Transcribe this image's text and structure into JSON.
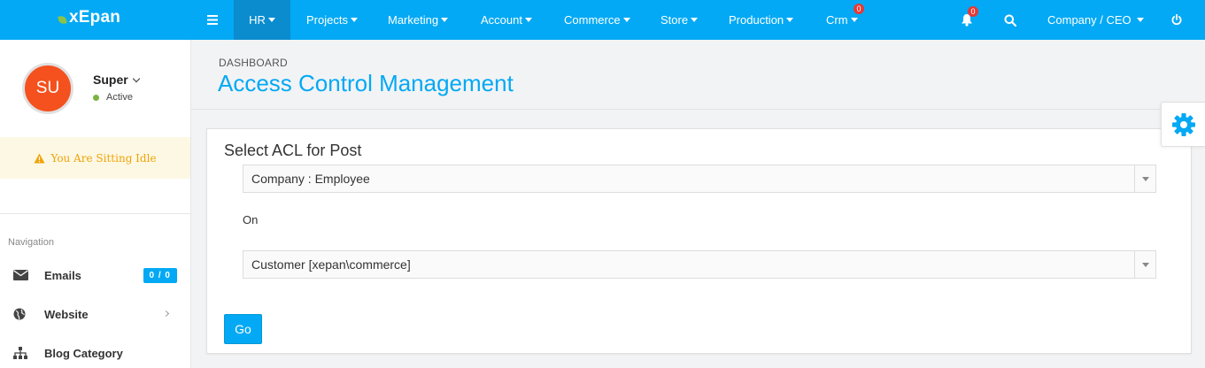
{
  "brand": {
    "name": "xEpan"
  },
  "topnav": {
    "items": [
      {
        "label": "HR"
      },
      {
        "label": "Projects"
      },
      {
        "label": "Marketing"
      },
      {
        "label": "Account"
      },
      {
        "label": "Commerce"
      },
      {
        "label": "Store"
      },
      {
        "label": "Production"
      },
      {
        "label": "Crm",
        "badge": "0"
      }
    ],
    "notification_badge": "0",
    "user_menu": "Company / CEO"
  },
  "sidebar": {
    "avatar_initials": "SU",
    "user_name": "Super",
    "user_status": "Active",
    "idle_message": "You Are Sitting Idle",
    "nav_heading": "Navigation",
    "items": [
      {
        "label": "Emails",
        "counter": "0 / 0",
        "icon": "envelope-icon"
      },
      {
        "label": "Website",
        "icon": "globe-icon"
      },
      {
        "label": "Blog Category",
        "icon": "sitemap-icon"
      }
    ]
  },
  "page": {
    "breadcrumb": "DASHBOARD",
    "title": "Access Control Management"
  },
  "form": {
    "label": "Select ACL for Post",
    "post_value": "Company : Employee",
    "on_label": "On",
    "entity_value": "Customer [xepan\\commerce]",
    "go_label": "Go"
  },
  "colors": {
    "primary": "#03a9f4",
    "active_nav": "#0a8ccf",
    "badge": "#e53935",
    "avatar": "#f4511e",
    "idle_bg": "#fcf8e3",
    "idle_text": "#f0a30a",
    "status_dot": "#7cb342"
  }
}
